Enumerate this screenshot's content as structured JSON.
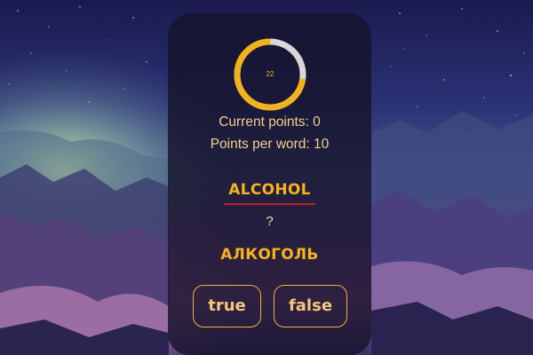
{
  "timer": {
    "value": "22",
    "progress_fraction": 0.73,
    "ring_color": "#f2b21b",
    "track_color": "#d8d8d8"
  },
  "stats": {
    "current_points": "Current points: 0",
    "points_per_word": "Points per word: 10"
  },
  "quiz": {
    "source_word": "ALCOHOL",
    "separator": "?",
    "translation": "АЛКОГОЛЬ"
  },
  "buttons": {
    "true_label": "true",
    "false_label": "false"
  },
  "colors": {
    "accent": "#f7b21c",
    "underline": "#c8182e",
    "card_bg": "#16142c"
  }
}
